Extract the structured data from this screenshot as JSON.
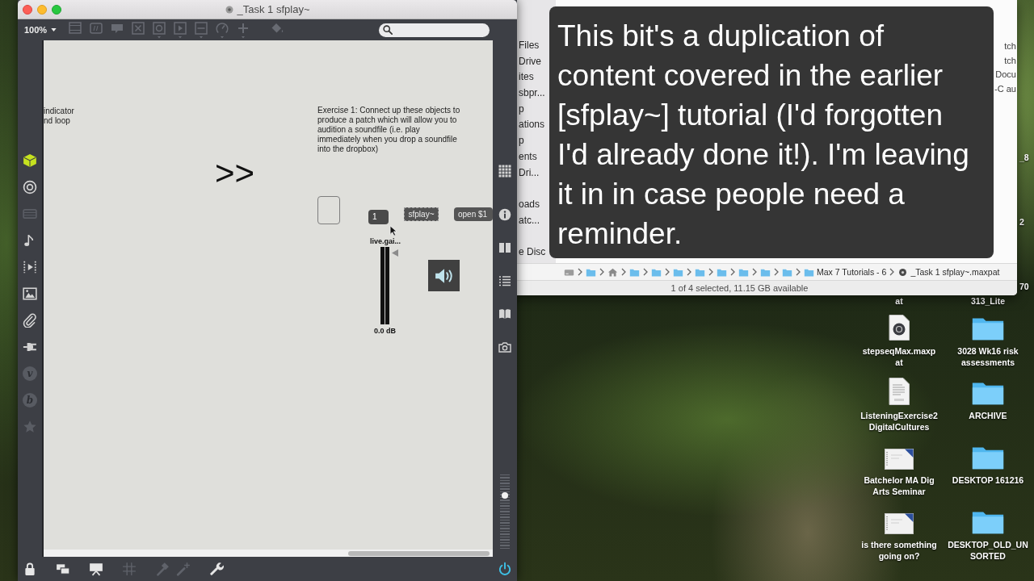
{
  "patcher_window": {
    "title": "_Task 1 sfplay~",
    "zoom": "100%",
    "toolbar": [
      {
        "kind": "panel",
        "disabled": true
      },
      {
        "kind": "message",
        "disabled": true
      },
      {
        "kind": "comment",
        "disabled": true
      },
      {
        "kind": "button",
        "disabled": true
      },
      {
        "kind": "toggle",
        "disabled": true
      },
      {
        "kind": "play",
        "disabled": true
      },
      {
        "kind": "slider",
        "disabled": true
      },
      {
        "kind": "dial",
        "disabled": true
      },
      {
        "kind": "plus",
        "disabled": true
      },
      {
        "kind": "paint",
        "disabled": true
      }
    ],
    "left_tools": [
      {
        "kind": "cube",
        "disabled": false
      },
      {
        "kind": "target",
        "disabled": false
      },
      {
        "kind": "film",
        "disabled": true
      },
      {
        "kind": "note",
        "disabled": false
      },
      {
        "kind": "media",
        "disabled": false
      },
      {
        "kind": "image",
        "disabled": false
      },
      {
        "kind": "paperclip",
        "disabled": false
      },
      {
        "kind": "plug",
        "disabled": false
      },
      {
        "kind": "letter",
        "glyph": "v",
        "disabled": true
      },
      {
        "kind": "letter",
        "glyph": "b",
        "disabled": true
      },
      {
        "kind": "star",
        "disabled": true
      }
    ],
    "right_tools": [
      {
        "kind": "grid"
      },
      {
        "kind": "info"
      },
      {
        "kind": "columns"
      },
      {
        "kind": "list"
      },
      {
        "kind": "book"
      },
      {
        "kind": "camera"
      }
    ],
    "master_volume": {
      "level": 0.72
    },
    "bottom_tools": [
      {
        "kind": "lock",
        "disabled": false
      },
      {
        "kind": "windows",
        "disabled": false
      },
      {
        "kind": "presentation",
        "disabled": false
      },
      {
        "kind": "grid",
        "disabled": true
      },
      {
        "kind": "hammer",
        "disabled": true
      },
      {
        "kind": "wand",
        "disabled": true
      },
      {
        "kind": "wrench",
        "disabled": false
      }
    ],
    "audio_on": true,
    "patch": [
      {
        "kind": "comment",
        "text": "indicator nd loop"
      },
      {
        "kind": "big_comment",
        "text": ">>"
      },
      {
        "kind": "comment",
        "text": "Exercise 1: Connect up these objects to produce a patch which will allow you to audition a soundfile (i.e. play immediately when you drop a soundfile into the dropbox)"
      },
      {
        "kind": "dropbox"
      },
      {
        "kind": "number",
        "text": "1"
      },
      {
        "kind": "object",
        "text": "sfplay~"
      },
      {
        "kind": "message",
        "text": "open $1"
      },
      {
        "kind": "gain",
        "label": "live.gai...",
        "level": 0.92,
        "reading": "0.0 dB"
      },
      {
        "kind": "dac"
      }
    ]
  },
  "finder_window": {
    "sidebar": [
      "Files",
      "Drive",
      "ites",
      "sbpr...",
      "p",
      "ations",
      "p",
      "ents",
      "Dri...",
      "oads",
      "atc...",
      "e Disc"
    ],
    "kind_column": [
      "tch",
      "tch",
      "Docu",
      "-C au"
    ],
    "path": [
      {
        "kind": "disk"
      },
      {
        "kind": "folder"
      },
      {
        "kind": "home"
      },
      {
        "kind": "folder"
      },
      {
        "kind": "folder"
      },
      {
        "kind": "folder"
      },
      {
        "kind": "folder"
      },
      {
        "kind": "folder"
      },
      {
        "kind": "folder"
      },
      {
        "kind": "folder"
      },
      {
        "kind": "folder"
      },
      {
        "kind": "folder",
        "label": "Max 7 Tutorials - 6"
      },
      {
        "kind": "file",
        "label": "_Task 1 sfplay~.maxpat"
      }
    ],
    "status": "1 of 4 selected, 11.15 GB available"
  },
  "caption": {
    "text": "This bit's a duplication of content covered in the earlier [sfplay~] tutorial (I'd forgotten I'd already done it!). I'm leaving it in in case people need a reminder."
  },
  "desktop": {
    "icons": [
      {
        "kind": "partial",
        "lines": [
          "at"
        ]
      },
      {
        "kind": "partial",
        "lines": [
          "313_Lite"
        ]
      },
      {
        "kind": "maxpat",
        "lines": [
          "stepseqMax.maxp",
          "at"
        ]
      },
      {
        "kind": "folder",
        "lines": [
          "3028 Wk16 risk",
          "assessments"
        ]
      },
      {
        "kind": "docx",
        "lines": [
          "ListeningExercise2",
          "DigitalCultures"
        ]
      },
      {
        "kind": "folder",
        "lines": [
          "ARCHIVE"
        ]
      },
      {
        "kind": "slides",
        "lines": [
          "Batchelor MA Dig",
          "Arts Seminar"
        ]
      },
      {
        "kind": "folder",
        "lines": [
          "DESKTOP 161216"
        ]
      },
      {
        "kind": "slides",
        "lines": [
          "is there something",
          "going on?"
        ]
      },
      {
        "kind": "folder",
        "lines": [
          "DESKTOP_OLD_UN",
          "SORTED"
        ]
      }
    ],
    "edge_labels": [
      "_8",
      "2",
      "70"
    ]
  }
}
